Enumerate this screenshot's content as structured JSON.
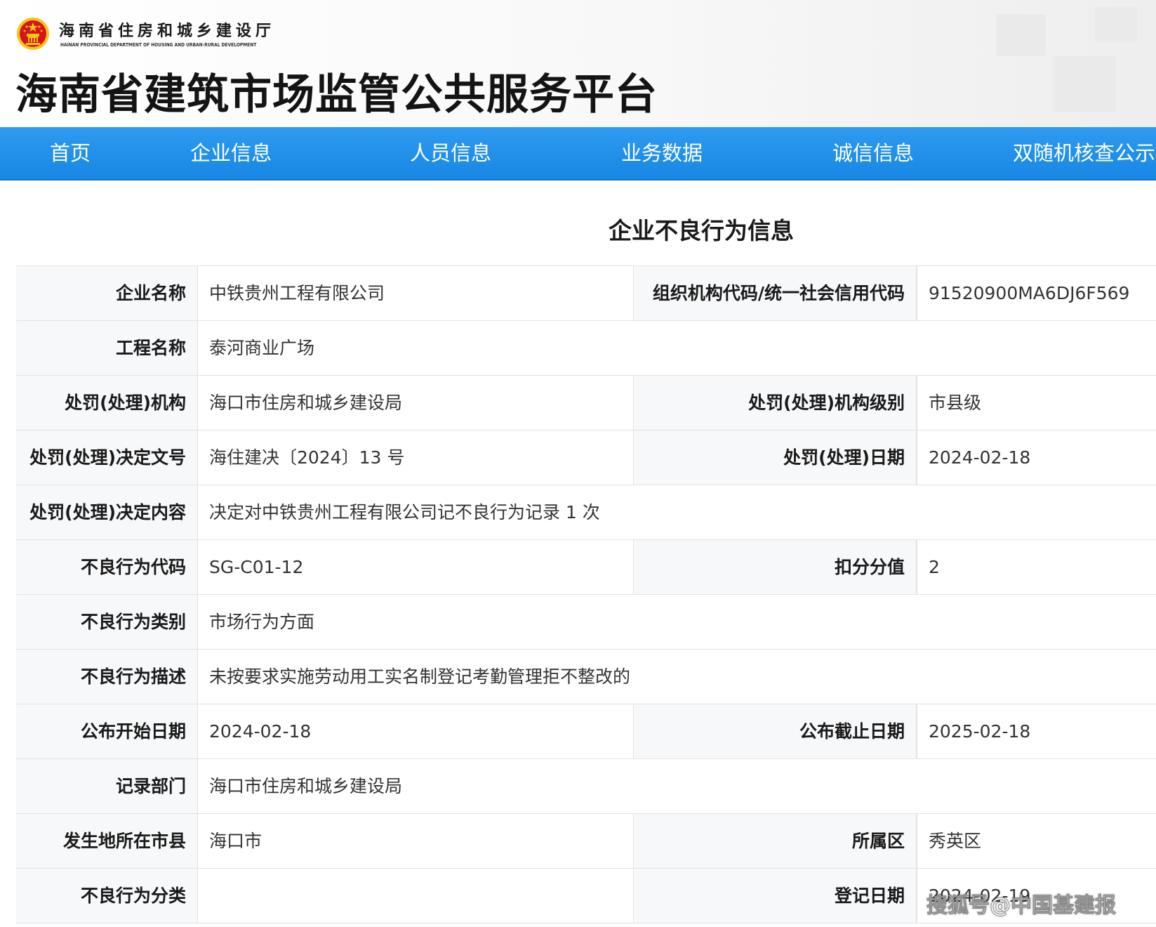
{
  "header": {
    "dept_name": "海南省住房和城乡建设厅",
    "dept_name_en": "HAINAN PROVINCIAL DEPARTMENT OF HOUSING AND URBAN-RURAL DEVELOPMENT",
    "platform_title": "海南省建筑市场监管公共服务平台",
    "emblem_icon": "national-emblem-icon"
  },
  "nav": {
    "items": [
      {
        "label": "首页"
      },
      {
        "label": "企业信息"
      },
      {
        "label": "人员信息"
      },
      {
        "label": "业务数据"
      },
      {
        "label": "诚信信息"
      },
      {
        "label": "双随机核查公示"
      }
    ]
  },
  "section": {
    "title": "企业不良行为信息"
  },
  "record": {
    "company_name_label": "企业名称",
    "company_name": "中铁贵州工程有限公司",
    "credit_code_label": "组织机构代码/统一社会信用代码",
    "credit_code": "91520900MA6DJ6F569",
    "project_name_label": "工程名称",
    "project_name": "泰河商业广场",
    "authority_label": "处罚(处理)机构",
    "authority": "海口市住房和城乡建设局",
    "authority_level_label": "处罚(处理)机构级别",
    "authority_level": "市县级",
    "decision_no_label": "处罚(处理)决定文号",
    "decision_no": "海住建决〔2024〕13 号",
    "decision_date_label": "处罚(处理)日期",
    "decision_date": "2024-02-18",
    "decision_content_label": "处罚(处理)决定内容",
    "decision_content": "决定对中铁贵州工程有限公司记不良行为记录 1 次",
    "behavior_code_label": "不良行为代码",
    "behavior_code": "SG-C01-12",
    "deduction_label": "扣分分值",
    "deduction": "2",
    "behavior_category_label": "不良行为类别",
    "behavior_category": "市场行为方面",
    "behavior_desc_label": "不良行为描述",
    "behavior_desc": "未按要求实施劳动用工实名制登记考勤管理拒不整改的",
    "publish_start_label": "公布开始日期",
    "publish_start": "2024-02-18",
    "publish_end_label": "公布截止日期",
    "publish_end": "2025-02-18",
    "record_dept_label": "记录部门",
    "record_dept": "海口市住房和城乡建设局",
    "city_label": "发生地所在市县",
    "city": "海口市",
    "district_label": "所属区",
    "district": "秀英区",
    "behavior_class_label": "不良行为分类",
    "behavior_class": "",
    "register_date_label": "登记日期",
    "register_date": "2024-02-19"
  },
  "watermark": "搜狐号@中国基建报",
  "colors": {
    "nav_bg": "#1787e4",
    "label_bg": "#f7f8fa",
    "border": "#e3e3e3",
    "emblem_red": "#d7141a",
    "emblem_gold": "#f5c518"
  }
}
